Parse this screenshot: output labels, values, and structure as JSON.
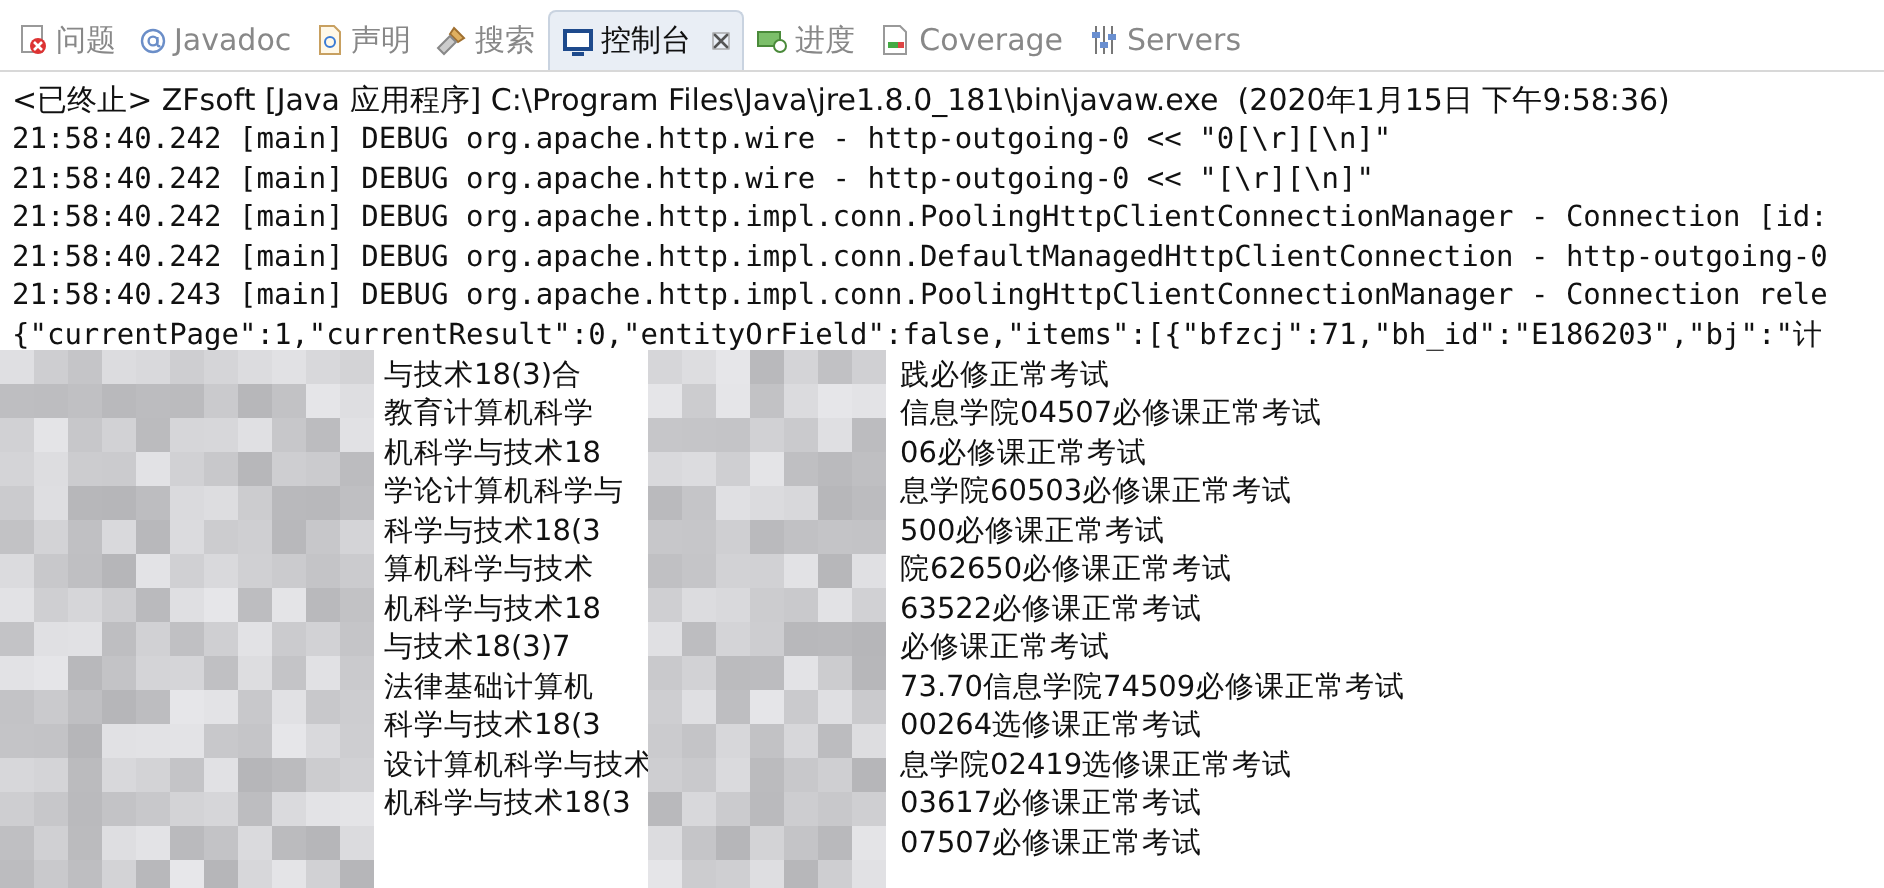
{
  "tabs": [
    {
      "label": "问题",
      "selected": false,
      "closable": false
    },
    {
      "label": "Javadoc",
      "selected": false,
      "closable": false
    },
    {
      "label": "声明",
      "selected": false,
      "closable": false
    },
    {
      "label": "搜索",
      "selected": false,
      "closable": false
    },
    {
      "label": "控制台",
      "selected": true,
      "closable": true
    },
    {
      "label": "进度",
      "selected": false,
      "closable": false
    },
    {
      "label": "Coverage",
      "selected": false,
      "closable": false
    },
    {
      "label": "Servers",
      "selected": false,
      "closable": false
    }
  ],
  "console": {
    "header": "<已终止> ZFsoft [Java 应用程序] C:\\Program Files\\Java\\jre1.8.0_181\\bin\\javaw.exe  (2020年1月15日 下午9:58:36)",
    "lines": [
      "21:58:40.242 [main] DEBUG org.apache.http.wire - http-outgoing-0 << \"0[\\r][\\n]\"",
      "21:58:40.242 [main] DEBUG org.apache.http.wire - http-outgoing-0 << \"[\\r][\\n]\"",
      "21:58:40.242 [main] DEBUG org.apache.http.impl.conn.PoolingHttpClientConnectionManager - Connection [id:",
      "21:58:40.242 [main] DEBUG org.apache.http.impl.conn.DefaultManagedHttpClientConnection - http-outgoing-0",
      "21:58:40.243 [main] DEBUG org.apache.http.impl.conn.PoolingHttpClientConnectionManager - Connection rele",
      "{\"currentPage\":1,\"currentResult\":0,\"entityOrField\":false,\"items\":[{\"bfzcj\":71,\"bh_id\":\"E186203\",\"bj\":\"计"
    ],
    "records": [
      {
        "left": "与技术18(3)合",
        "right": "践必修正常考试"
      },
      {
        "left": "教育计算机科学",
        "right": "信息学院04507必修课正常考试"
      },
      {
        "left": "机科学与技术18",
        "right": "06必修课正常考试"
      },
      {
        "left": "学论计算机科学与",
        "right": "息学院60503必修课正常考试"
      },
      {
        "left": "科学与技术18(3",
        "right": "500必修课正常考试"
      },
      {
        "left": "算机科学与技术",
        "right": "院62650必修课正常考试"
      },
      {
        "left": "机科学与技术18",
        "right": "63522必修课正常考试"
      },
      {
        "left": "与技术18(3)7",
        "right": "必修课正常考试"
      },
      {
        "left": "法律基础计算机",
        "right": "73.70信息学院74509必修课正常考试"
      },
      {
        "left": "科学与技术18(3",
        "right": "00264选修课正常考试"
      },
      {
        "left": "设计算机科学与技术",
        "right": "息学院02419选修课正常考试"
      },
      {
        "left": "机科学与技术18(3",
        "right": "03617必修课正常考试"
      },
      {
        "right": "07507必修课正常考试"
      }
    ]
  }
}
